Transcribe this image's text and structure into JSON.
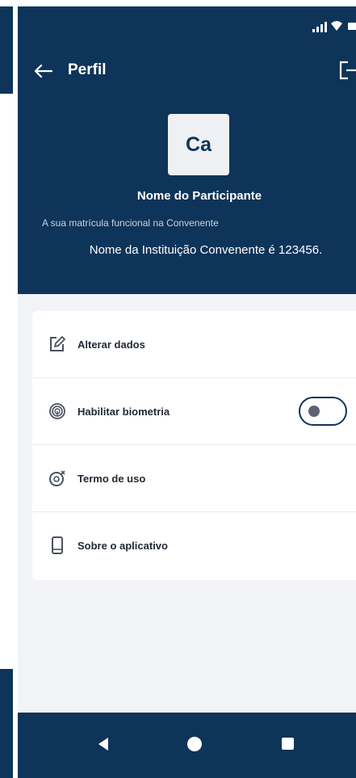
{
  "header": {
    "title": "Perfil",
    "back_icon": "arrow-left-icon",
    "logout_icon": "logout-icon"
  },
  "profile": {
    "avatar_initials": "Ca",
    "name": "Nome do Participante",
    "matricula_label": "A sua matrícula funcional na Convenente",
    "instituicao_text": "Nome da Instituição Convenente é 123456."
  },
  "menu": {
    "items": [
      {
        "label": "Alterar dados",
        "icon": "edit-icon"
      },
      {
        "label": "Habilitar biometria",
        "icon": "fingerprint-icon",
        "toggle_on": false
      },
      {
        "label": "Termo de uso",
        "icon": "terms-icon"
      },
      {
        "label": "Sobre o aplicativo",
        "icon": "phone-icon"
      }
    ]
  },
  "colors": {
    "primary": "#0f3459",
    "background": "#f2f3f7",
    "card": "#ffffff"
  },
  "nav": {
    "icons": [
      "nav-back-icon",
      "nav-home-icon",
      "nav-recent-icon"
    ]
  }
}
